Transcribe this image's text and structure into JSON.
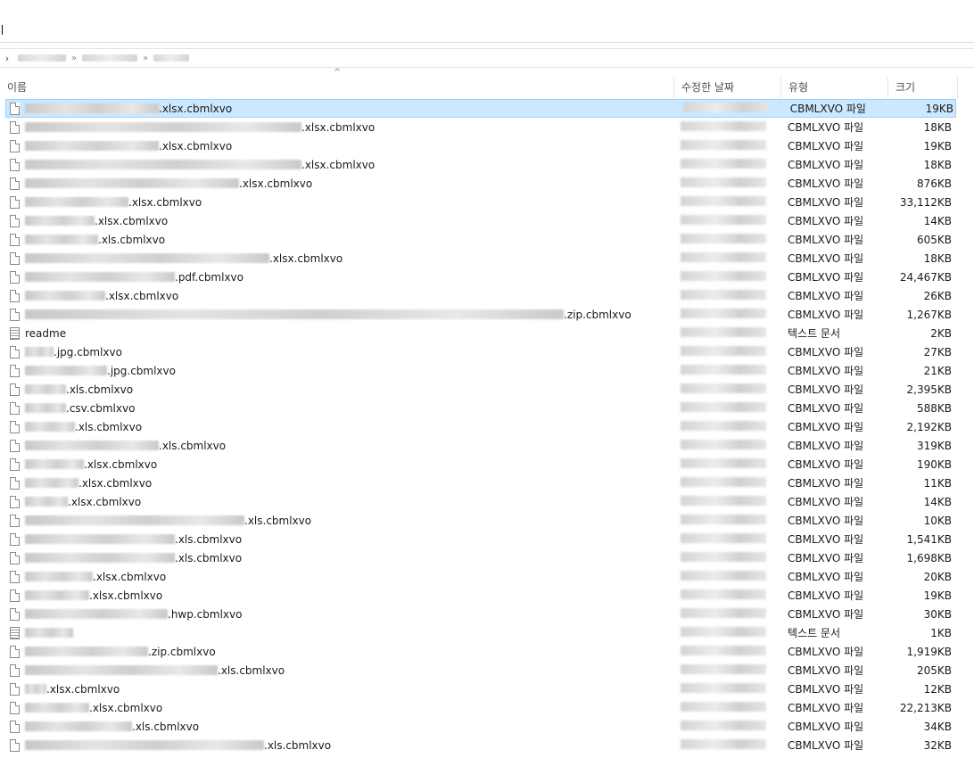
{
  "columns": {
    "name": "이름",
    "date": "수정한 날짜",
    "type": "유형",
    "size": "크기",
    "sort_glyph": "^"
  },
  "address": {
    "chevron": "›",
    "separator_glyphs": [
      "»",
      "»"
    ]
  },
  "files": [
    {
      "ext": ".xlsx.cbmlxvo",
      "type": "CBMLXVO 파일",
      "size": "19KB",
      "w": 150,
      "icon": "file",
      "selected": true
    },
    {
      "ext": ".xlsx.cbmlxvo",
      "type": "CBMLXVO 파일",
      "size": "18KB",
      "w": 310,
      "icon": "file"
    },
    {
      "ext": ".xlsx.cbmlxvo",
      "type": "CBMLXVO 파일",
      "size": "19KB",
      "w": 150,
      "icon": "file"
    },
    {
      "ext": ".xlsx.cbmlxvo",
      "type": "CBMLXVO 파일",
      "size": "18KB",
      "w": 310,
      "icon": "file"
    },
    {
      "ext": ".xlsx.cbmlxvo",
      "type": "CBMLXVO 파일",
      "size": "876KB",
      "w": 240,
      "icon": "file"
    },
    {
      "ext": ".xlsx.cbmlxvo",
      "type": "CBMLXVO 파일",
      "size": "33,112KB",
      "w": 116,
      "icon": "file"
    },
    {
      "ext": ".xlsx.cbmlxvo",
      "type": "CBMLXVO 파일",
      "size": "14KB",
      "w": 78,
      "icon": "file"
    },
    {
      "ext": ".xls.cbmlxvo",
      "type": "CBMLXVO 파일",
      "size": "605KB",
      "w": 82,
      "icon": "file"
    },
    {
      "ext": ".xlsx.cbmlxvo",
      "type": "CBMLXVO 파일",
      "size": "18KB",
      "w": 274,
      "icon": "file"
    },
    {
      "ext": ".pdf.cbmlxvo",
      "type": "CBMLXVO 파일",
      "size": "24,467KB",
      "w": 168,
      "icon": "file"
    },
    {
      "ext": ".xlsx.cbmlxvo",
      "type": "CBMLXVO 파일",
      "size": "26KB",
      "w": 90,
      "icon": "file"
    },
    {
      "ext": ".zip.cbmlxvo",
      "type": "CBMLXVO 파일",
      "size": "1,267KB",
      "w": 604,
      "icon": "file"
    },
    {
      "name": "readme",
      "type": "텍스트 문서",
      "size": "2KB",
      "w": 0,
      "icon": "text"
    },
    {
      "ext": ".jpg.cbmlxvo",
      "type": "CBMLXVO 파일",
      "size": "27KB",
      "w": 32,
      "icon": "file"
    },
    {
      "ext": ".jpg.cbmlxvo",
      "type": "CBMLXVO 파일",
      "size": "21KB",
      "w": 92,
      "icon": "file"
    },
    {
      "ext": ".xls.cbmlxvo",
      "type": "CBMLXVO 파일",
      "size": "2,395KB",
      "w": 46,
      "icon": "file"
    },
    {
      "ext": ".csv.cbmlxvo",
      "type": "CBMLXVO 파일",
      "size": "588KB",
      "w": 46,
      "icon": "file"
    },
    {
      "ext": ".xls.cbmlxvo",
      "type": "CBMLXVO 파일",
      "size": "2,192KB",
      "w": 56,
      "icon": "file"
    },
    {
      "ext": ".xls.cbmlxvo",
      "type": "CBMLXVO 파일",
      "size": "319KB",
      "w": 150,
      "icon": "file"
    },
    {
      "ext": ".xlsx.cbmlxvo",
      "type": "CBMLXVO 파일",
      "size": "190KB",
      "w": 66,
      "icon": "file"
    },
    {
      "ext": ".xlsx.cbmlxvo",
      "type": "CBMLXVO 파일",
      "size": "11KB",
      "w": 60,
      "icon": "file"
    },
    {
      "ext": ".xlsx.cbmlxvo",
      "type": "CBMLXVO 파일",
      "size": "14KB",
      "w": 48,
      "icon": "file"
    },
    {
      "ext": ".xls.cbmlxvo",
      "type": "CBMLXVO 파일",
      "size": "10KB",
      "w": 246,
      "icon": "file"
    },
    {
      "ext": ".xls.cbmlxvo",
      "type": "CBMLXVO 파일",
      "size": "1,541KB",
      "w": 168,
      "icon": "file"
    },
    {
      "ext": ".xls.cbmlxvo",
      "type": "CBMLXVO 파일",
      "size": "1,698KB",
      "w": 168,
      "icon": "file"
    },
    {
      "ext": ".xlsx.cbmlxvo",
      "type": "CBMLXVO 파일",
      "size": "20KB",
      "w": 76,
      "icon": "file"
    },
    {
      "ext": ".xlsx.cbmlxvo",
      "type": "CBMLXVO 파일",
      "size": "19KB",
      "w": 72,
      "icon": "file"
    },
    {
      "ext": ".hwp.cbmlxvo",
      "type": "CBMLXVO 파일",
      "size": "30KB",
      "w": 160,
      "icon": "file"
    },
    {
      "name": "",
      "type": "텍스트 문서",
      "size": "1KB",
      "w": 54,
      "icon": "text"
    },
    {
      "ext": ".zip.cbmlxvo",
      "type": "CBMLXVO 파일",
      "size": "1,919KB",
      "w": 138,
      "icon": "file"
    },
    {
      "ext": ".xls.cbmlxvo",
      "type": "CBMLXVO 파일",
      "size": "205KB",
      "w": 216,
      "icon": "file"
    },
    {
      "ext": ".xlsx.cbmlxvo",
      "type": "CBMLXVO 파일",
      "size": "12KB",
      "w": 24,
      "icon": "file"
    },
    {
      "ext": ".xlsx.cbmlxvo",
      "type": "CBMLXVO 파일",
      "size": "22,213KB",
      "w": 72,
      "icon": "file"
    },
    {
      "ext": ".xls.cbmlxvo",
      "type": "CBMLXVO 파일",
      "size": "34KB",
      "w": 120,
      "icon": "file"
    },
    {
      "ext": ".xls.cbmlxvo",
      "type": "CBMLXVO 파일",
      "size": "32KB",
      "w": 268,
      "icon": "file"
    }
  ]
}
